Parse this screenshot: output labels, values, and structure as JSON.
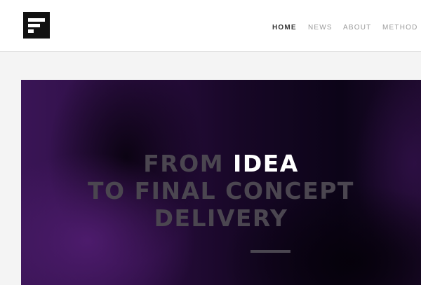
{
  "header": {
    "logo_icon": "f-logo-icon",
    "nav": [
      {
        "label": "HOME",
        "active": true
      },
      {
        "label": "NEWS",
        "active": false
      },
      {
        "label": "ABOUT",
        "active": false
      },
      {
        "label": "METHOD",
        "active": false
      }
    ]
  },
  "hero": {
    "line1_prefix": "FROM",
    "line1_highlight": "IDEA",
    "line2": "TO FINAL CONCEPT",
    "line3": "DELIVERY"
  },
  "colors": {
    "highlight": "#ffffff",
    "muted_text": "#4b4650",
    "hero_purple": "#3a1556",
    "hero_dark": "#0c0418"
  }
}
